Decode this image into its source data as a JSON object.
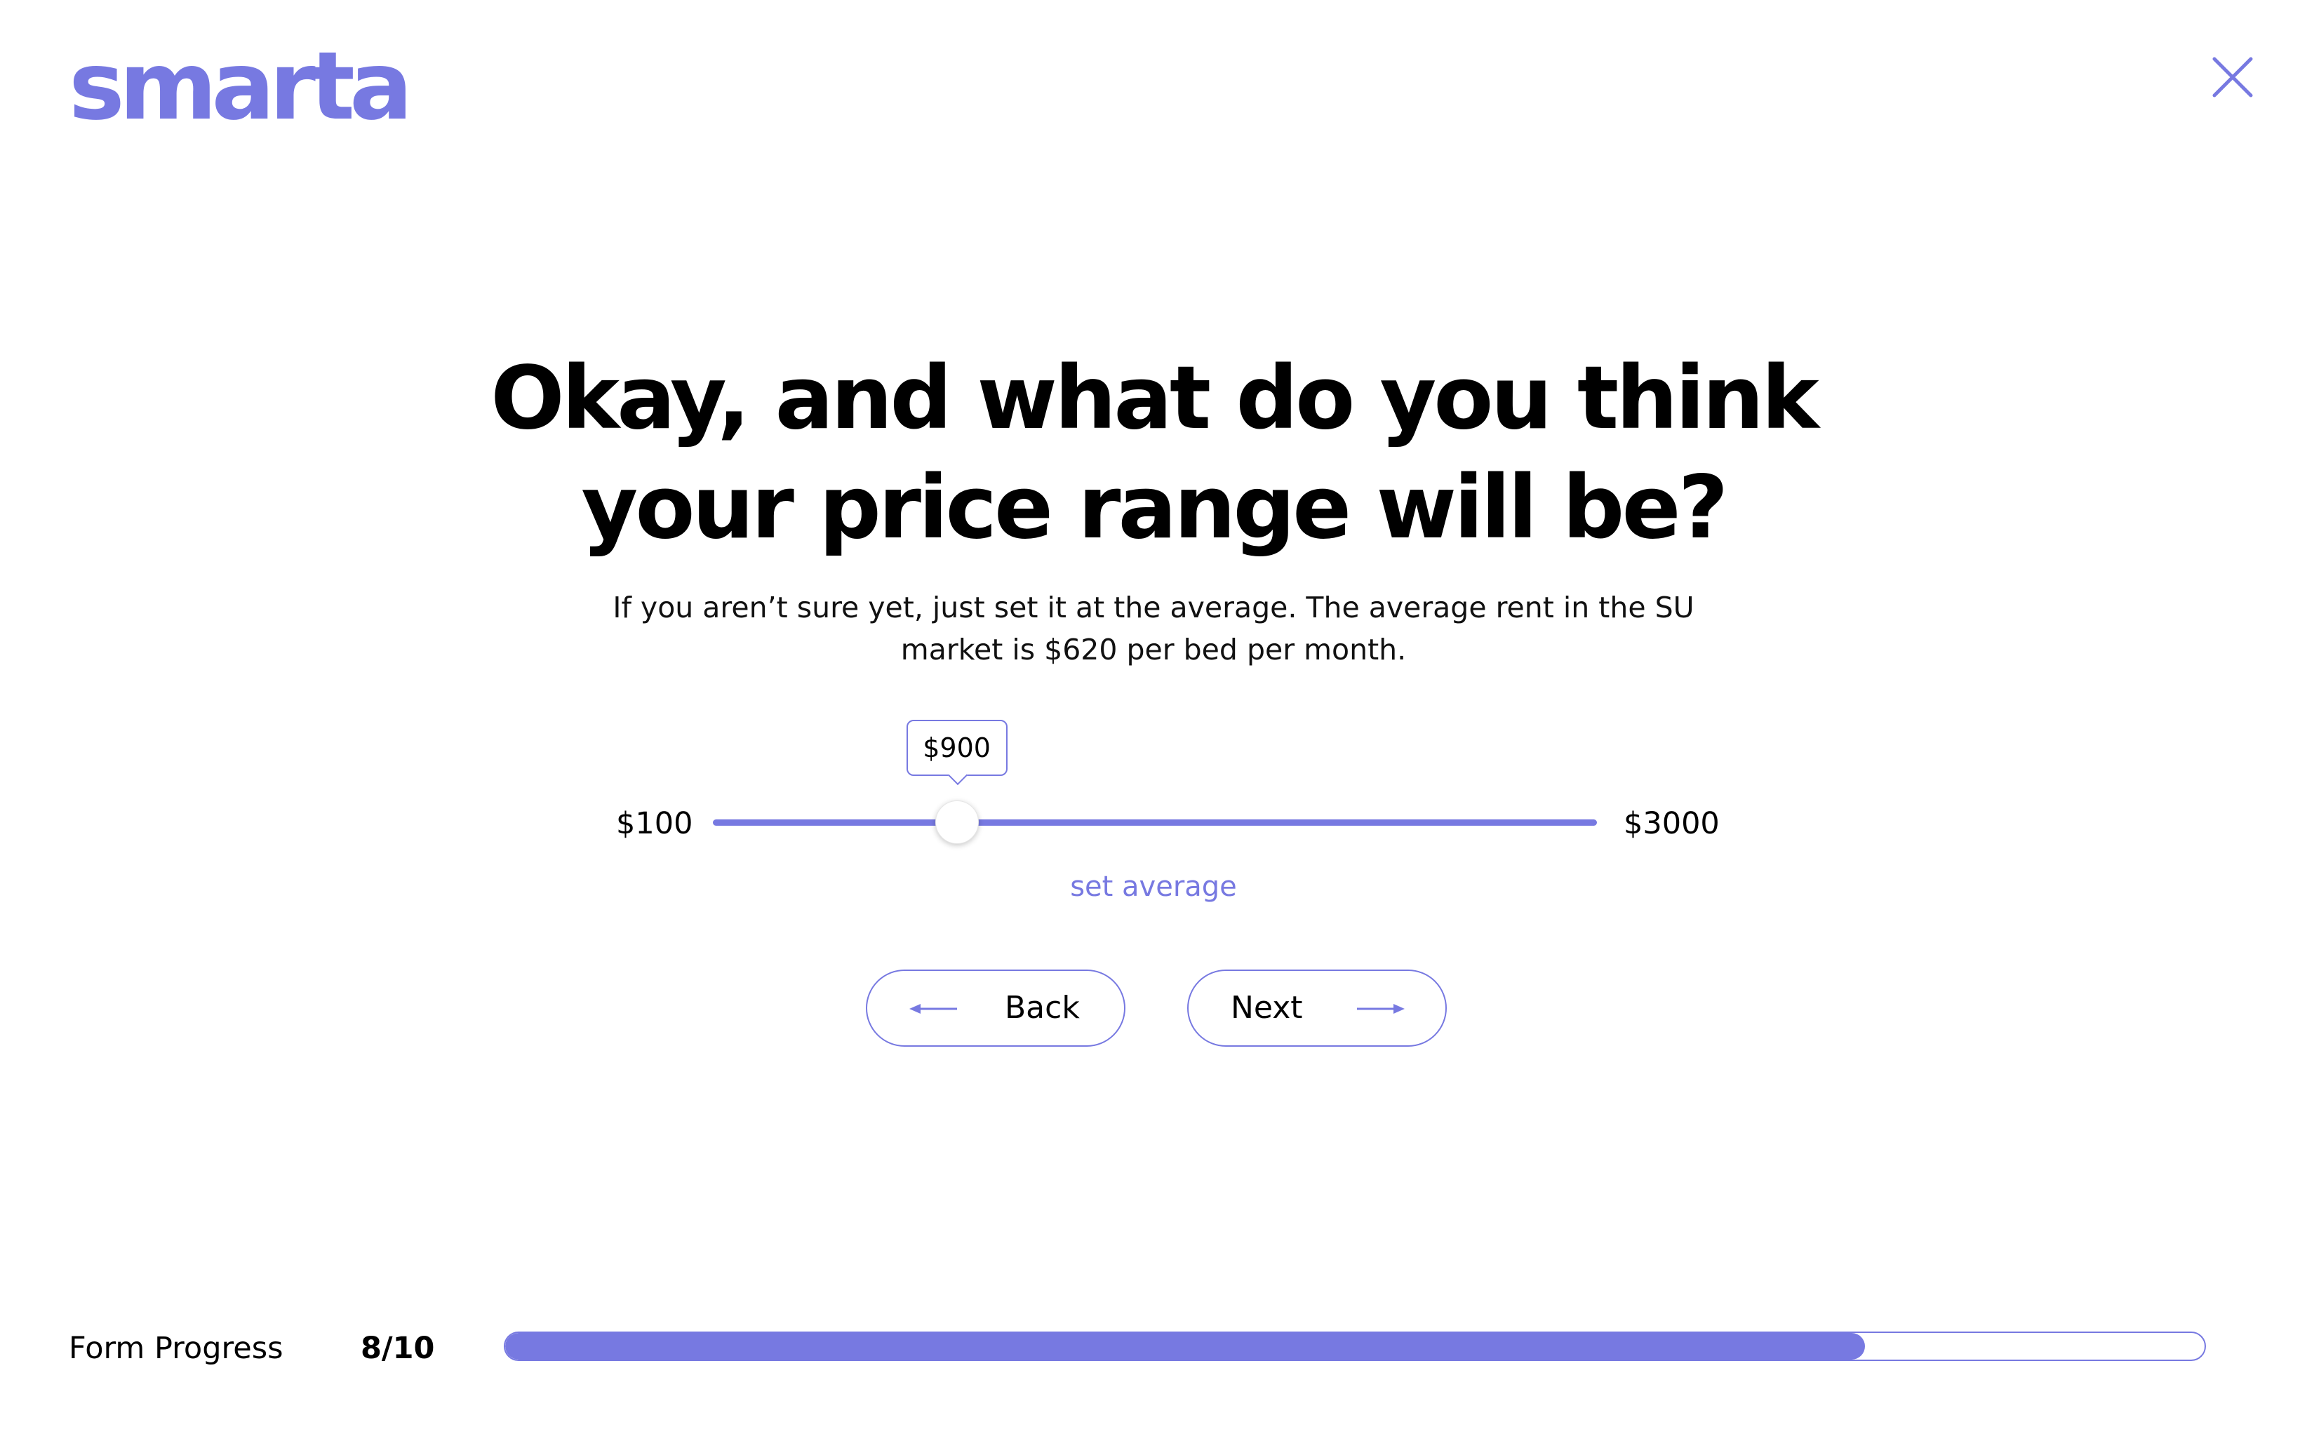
{
  "brand": {
    "name": "smarta",
    "color": "#7779e1"
  },
  "header": {
    "close_icon": "close-icon"
  },
  "question": {
    "title": "Okay, and what do you think your price range will be?",
    "subtitle": "If you aren’t sure yet, just set it at the average. The average rent in the SU market is $620 per bed per month."
  },
  "price_slider": {
    "min_label": "$100",
    "max_label": "$3000",
    "min": 100,
    "max": 3000,
    "value": 900,
    "value_label": "$900",
    "set_average_label": "set average"
  },
  "navigation": {
    "back_label": "Back",
    "back_icon": "arrow-left-icon",
    "next_label": "Next",
    "next_icon": "arrow-right-icon"
  },
  "progress": {
    "label": "Form Progress",
    "count_text": "8/10",
    "current": 8,
    "total": 10
  }
}
